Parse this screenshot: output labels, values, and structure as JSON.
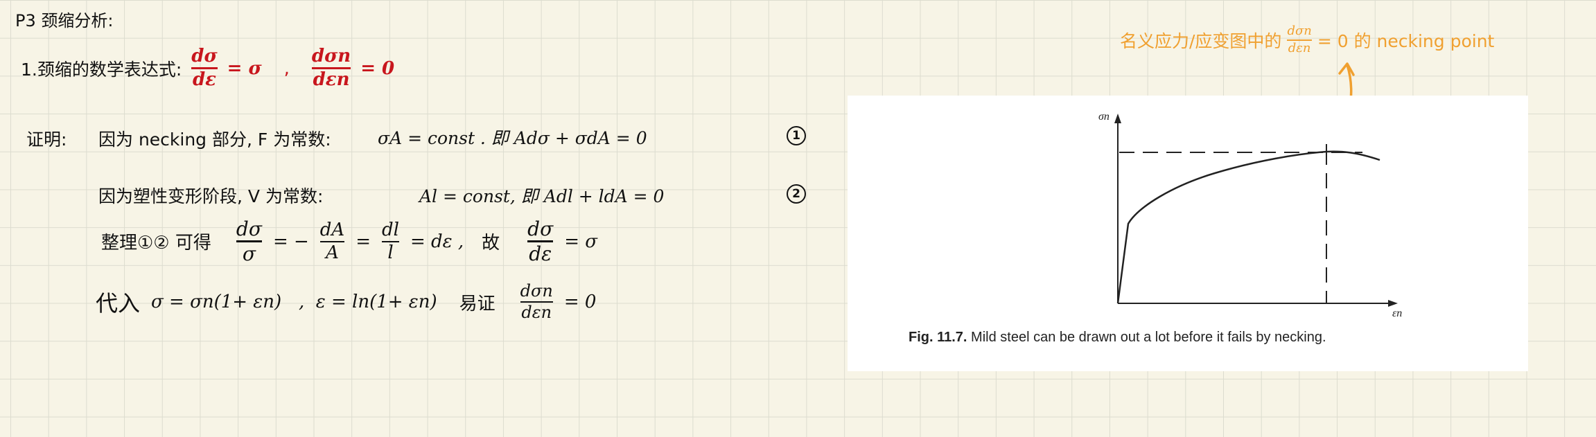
{
  "title": "P3 颈缩分析:",
  "item1": {
    "label": "1.颈缩的数学表达式:",
    "eq1": {
      "num": "dσ",
      "den": "dε",
      "rhs": "= σ"
    },
    "sep": ",",
    "eq2": {
      "num": "dσn",
      "den": "dεn",
      "rhs": "= 0"
    }
  },
  "proof": {
    "label": "证明:",
    "line1": {
      "text": "因为 necking 部分, F 为常数:",
      "math": "σA = const . 即  Adσ + σdA = 0",
      "marker": "1"
    },
    "line2": {
      "text": "因为塑性变形阶段, V 为常数:",
      "math": "Al = const, 即  Adl + ldA = 0",
      "marker": "2"
    },
    "line3": {
      "prefix": "整理①② 可得",
      "f1": {
        "num": "dσ",
        "den": "σ"
      },
      "op1": "= −",
      "f2": {
        "num": "dA",
        "den": "A"
      },
      "op2": "=",
      "f3": {
        "num": "dl",
        "den": "l"
      },
      "op3": "= dε ,",
      "gu": "故",
      "f4": {
        "num": "dσ",
        "den": "dε"
      },
      "rhs": "= σ"
    },
    "line4": {
      "prefix": "代入",
      "math": "σ = σn(1+ εn)   ,  ε = ln(1+ εn)",
      "easy": "易证",
      "f": {
        "num": "dσn",
        "den": "dεn"
      },
      "rhs": "= 0"
    }
  },
  "annotation": {
    "text_before": "名义应力/应变图中的",
    "frac": {
      "num": "dσn",
      "den": "dεn"
    },
    "text_after": "= 0 的 necking point"
  },
  "figure": {
    "caption_bold": "Fig. 11.7.",
    "caption_text": " Mild steel can be drawn out a lot before it fails by necking.",
    "y_axis_label": "σn",
    "x_axis_label": "εn"
  }
}
